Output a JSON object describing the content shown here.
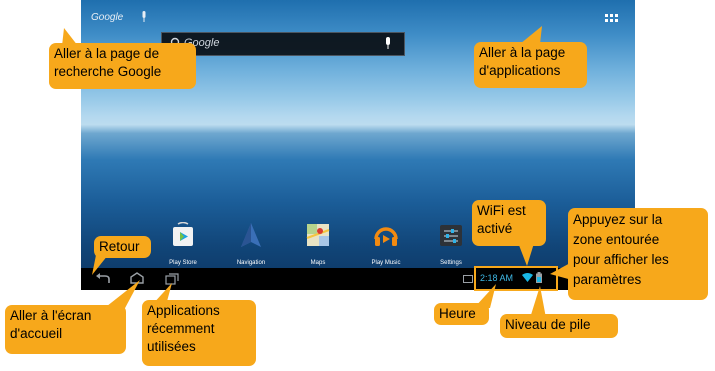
{
  "home_screen": {
    "google_word": "Google",
    "search_widget_text": "Google",
    "apps": [
      {
        "label": "Play Store",
        "icon": "play-store-icon"
      },
      {
        "label": "Navigation",
        "icon": "navigation-icon"
      },
      {
        "label": "Maps",
        "icon": "maps-icon"
      },
      {
        "label": "Play Music",
        "icon": "play-music-icon"
      },
      {
        "label": "Settings",
        "icon": "settings-icon"
      }
    ],
    "status": {
      "time": "2:18 AM",
      "wifi_icon": "wifi-icon",
      "battery_icon": "battery-icon"
    },
    "nav_icons": [
      "back-icon",
      "home-icon",
      "recent-apps-icon"
    ]
  },
  "callouts": {
    "google_search": [
      "Aller à la page de",
      "recherche Google"
    ],
    "apps_page": [
      "Aller à la page",
      "d'applications"
    ],
    "back": [
      "Retour"
    ],
    "home": [
      "Aller à l'écran",
      "d'accueil"
    ],
    "recent": [
      "Applications",
      "récemment",
      "utilisées"
    ],
    "wifi": [
      "WiFi est",
      "activé"
    ],
    "settings_area": [
      "Appuyez sur la",
      "zone entourée",
      "pour afficher les",
      "paramètres"
    ],
    "time": [
      "Heure"
    ],
    "battery": [
      "Niveau de pile"
    ]
  },
  "colors": {
    "callout": "#f7a81b",
    "status_outline": "#f7a81b",
    "wifi": "#19b7e6"
  }
}
